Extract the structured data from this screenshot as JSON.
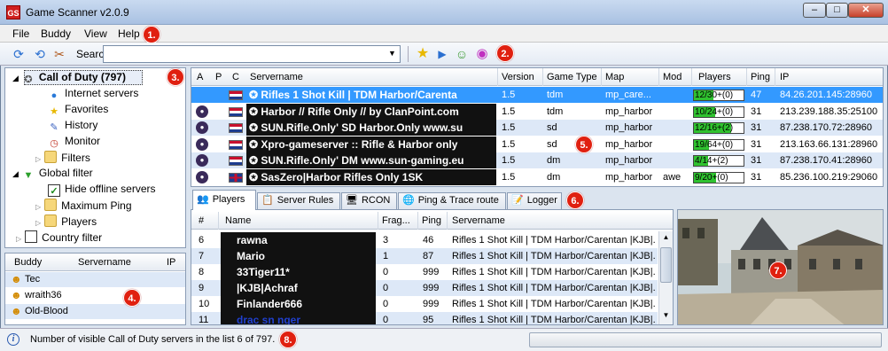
{
  "app": {
    "title": "Game Scanner v2.0.9",
    "icon_text": "GS"
  },
  "menu": [
    "File",
    "Buddy",
    "View",
    "Help"
  ],
  "toolbar": {
    "search_label": "Search",
    "search_value": ""
  },
  "badges": [
    "1.",
    "2.",
    "3.",
    "4.",
    "5.",
    "6.",
    "7.",
    "8."
  ],
  "tree": {
    "root": "Call of Duty (797)",
    "items": [
      "Internet servers",
      "Favorites",
      "History",
      "Monitor",
      "Filters"
    ],
    "global_filter": "Global filter",
    "global_items": [
      "Hide offline servers",
      "Maximum Ping",
      "Players"
    ],
    "country_filter": "Country filter"
  },
  "buddy": {
    "headers": [
      "Buddy",
      "Servername",
      "IP"
    ],
    "rows": [
      "Tec",
      "wraith36",
      "Old-Blood"
    ]
  },
  "servers": {
    "headers": [
      "A",
      "P",
      "C",
      "Servername",
      "Version",
      "Game Type",
      "Map",
      "Mod",
      "Players",
      "Ping",
      "IP"
    ],
    "rows": [
      {
        "name": "Rifles 1 Shot Kill | TDM Harbor/Carenta",
        "version": "1.5",
        "gametype": "tdm",
        "map": "mp_care...",
        "mod": "",
        "players": "12/30+(0)",
        "fill": 0.4,
        "ping": "47",
        "ip": "84.26.201.145:28960",
        "flag": "nl"
      },
      {
        "name": "Harbor // Rifle Only // by ClanPoint.com",
        "version": "1.5",
        "gametype": "tdm",
        "map": "mp_harbor",
        "mod": "",
        "players": "10/24+(0)",
        "fill": 0.42,
        "ping": "31",
        "ip": "213.239.188.35:25100",
        "flag": "nl"
      },
      {
        "name": "SUN.Rifle.Only' SD Harbor.Only www.su",
        "version": "1.5",
        "gametype": "sd",
        "map": "mp_harbor",
        "mod": "",
        "players": "12/16+(2)",
        "fill": 0.75,
        "ping": "31",
        "ip": "87.238.170.72:28960",
        "flag": "nl"
      },
      {
        "name": "Xpro-gameserver :: Rifle & Harbor only",
        "version": "1.5",
        "gametype": "sd",
        "map": "mp_harbor",
        "mod": "",
        "players": "19/64+(0)",
        "fill": 0.3,
        "ping": "31",
        "ip": "213.163.66.131:28960",
        "flag": "nl"
      },
      {
        "name": "SUN.Rifle.Only' DM www.sun-gaming.eu",
        "version": "1.5",
        "gametype": "dm",
        "map": "mp_harbor",
        "mod": "",
        "players": "4/14+(2)",
        "fill": 0.29,
        "ping": "31",
        "ip": "87.238.170.41:28960",
        "flag": "nl"
      },
      {
        "name": "SasZero|Harbor Rifles Only 1SK",
        "version": "1.5",
        "gametype": "dm",
        "map": "mp_harbor",
        "mod": "awe",
        "players": "9/20+(0)",
        "fill": 0.45,
        "ping": "31",
        "ip": "85.236.100.219:29060",
        "flag": "uk"
      }
    ]
  },
  "tabs": [
    "Players",
    "Server Rules",
    "RCON",
    "Ping & Trace route",
    "Logger"
  ],
  "players": {
    "headers": [
      "#",
      "Name",
      "Frag...",
      "Ping",
      "Servername"
    ],
    "rows": [
      {
        "n": "6",
        "name": "rawna",
        "frags": "3",
        "ping": "46",
        "server": "Rifles 1 Shot Kill | TDM Harbor/Carentan |KJB|..."
      },
      {
        "n": "7",
        "name": "Mario",
        "frags": "1",
        "ping": "87",
        "server": "Rifles 1 Shot Kill | TDM Harbor/Carentan |KJB|..."
      },
      {
        "n": "8",
        "name": "33Tiger11*",
        "frags": "0",
        "ping": "999",
        "server": "Rifles 1 Shot Kill | TDM Harbor/Carentan |KJB|..."
      },
      {
        "n": "9",
        "name": "|KJB|Achraf",
        "frags": "0",
        "ping": "999",
        "server": "Rifles 1 Shot Kill | TDM Harbor/Carentan |KJB|..."
      },
      {
        "n": "10",
        "name": "Finlander666",
        "frags": "0",
        "ping": "999",
        "server": "Rifles 1 Shot Kill | TDM Harbor/Carentan |KJB|..."
      },
      {
        "n": "11",
        "name": "drac sn nger",
        "frags": "0",
        "ping": "95",
        "server": "Rifles 1 Shot Kill | TDM Harbor/Carentan |KJB|..."
      }
    ]
  },
  "status": {
    "text": "Number of visible Call of Duty servers in the list 6 of 797."
  },
  "colors": {
    "accent_row": "#3399ff",
    "alt_row": "#dde8f7",
    "badge": "#e02010"
  }
}
